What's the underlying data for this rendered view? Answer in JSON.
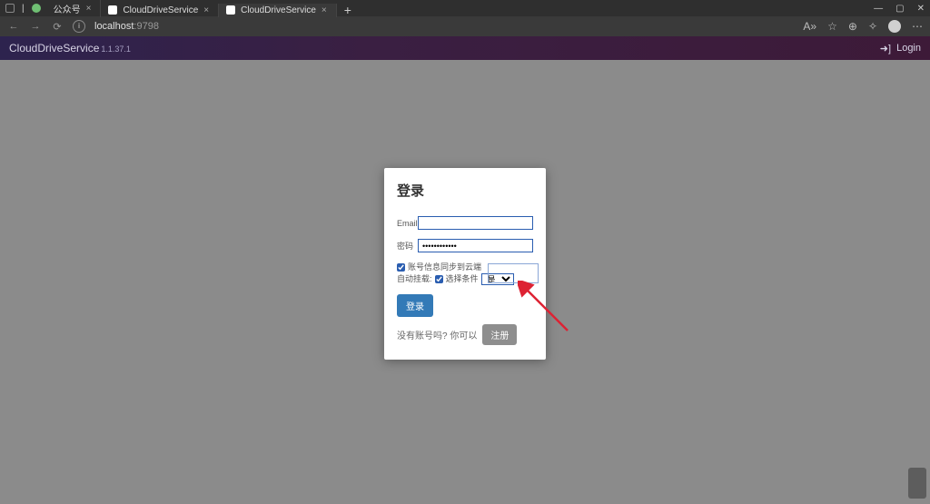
{
  "browser": {
    "tabs": [
      {
        "title": "公众号"
      },
      {
        "title": "CloudDriveService"
      },
      {
        "title": "CloudDriveService"
      }
    ],
    "url_host": "localhost",
    "url_port": ":9798"
  },
  "app": {
    "title": "CloudDriveService",
    "version": "1.1.37.1",
    "login_label": "Login"
  },
  "modal": {
    "title": "登录",
    "email_label": "Email",
    "email_value": "",
    "password_label": "密码",
    "password_value": "••••••••••••",
    "sync_label": "账号信息同步到云端",
    "automount_prefix": "自动挂载:",
    "select_label": "选择条件",
    "select_value": "是",
    "login_btn": "登录",
    "no_account_text": "没有账号吗? 你可以",
    "register_btn": "注册"
  }
}
